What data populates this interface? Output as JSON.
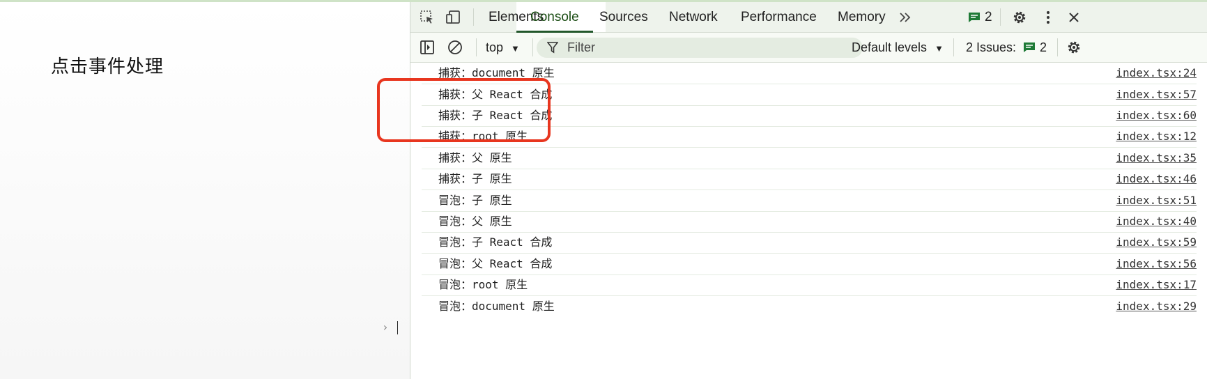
{
  "page": {
    "title": "点击事件处理"
  },
  "devtools": {
    "tabs": [
      "Elements",
      "Console",
      "Sources",
      "Network",
      "Performance",
      "Memory"
    ],
    "active_tab": "Console",
    "message_badge_count": "2",
    "toolbar": {
      "context": "top",
      "filter_placeholder": "Filter",
      "levels": "Default levels",
      "issues_label": "2 Issues:",
      "issues_count": "2"
    },
    "logs": [
      {
        "msg": "捕获：document 原生",
        "src": "index.tsx:24"
      },
      {
        "msg": "捕获：父 React 合成",
        "src": "index.tsx:57"
      },
      {
        "msg": "捕获：子 React 合成",
        "src": "index.tsx:60"
      },
      {
        "msg": "捕获：root 原生",
        "src": "index.tsx:12"
      },
      {
        "msg": "捕获：父 原生",
        "src": "index.tsx:35"
      },
      {
        "msg": "捕获：子 原生",
        "src": "index.tsx:46"
      },
      {
        "msg": "冒泡：子 原生",
        "src": "index.tsx:51"
      },
      {
        "msg": "冒泡：父 原生",
        "src": "index.tsx:40"
      },
      {
        "msg": "冒泡：子 React 合成",
        "src": "index.tsx:59"
      },
      {
        "msg": "冒泡：父 React 合成",
        "src": "index.tsx:56"
      },
      {
        "msg": "冒泡：root 原生",
        "src": "index.tsx:17"
      },
      {
        "msg": "冒泡：document 原生",
        "src": "index.tsx:29"
      }
    ],
    "colors": {
      "highlight": "#e8361f",
      "active_tab": "#22572b",
      "badge": "#1e7a36"
    }
  }
}
